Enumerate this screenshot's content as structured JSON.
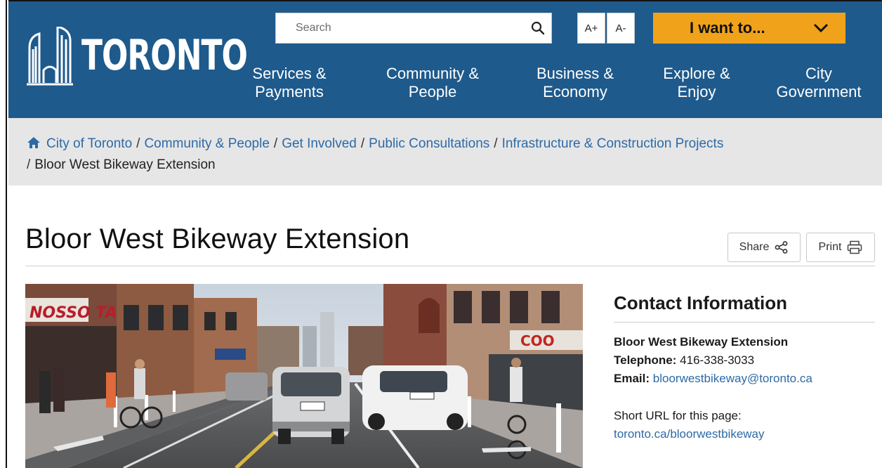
{
  "header": {
    "logo_text": "TORONTO",
    "search_placeholder": "Search",
    "font_increase": "A+",
    "font_decrease": "A-",
    "i_want_to": "I want to...",
    "nav": [
      {
        "line1": "Services &",
        "line2": "Payments"
      },
      {
        "line1": "Community &",
        "line2": "People"
      },
      {
        "line1": "Business &",
        "line2": "Economy"
      },
      {
        "line1": "Explore &",
        "line2": "Enjoy"
      },
      {
        "line1": "City",
        "line2": "Government"
      }
    ]
  },
  "breadcrumb": {
    "items": [
      "City of Toronto",
      "Community & People",
      "Get Involved",
      "Public Consultations",
      "Infrastructure & Construction Projects"
    ],
    "separator": "/",
    "current": "Bloor West Bikeway Extension"
  },
  "page": {
    "title": "Bloor West Bikeway Extension",
    "share_label": "Share",
    "print_label": "Print"
  },
  "contact": {
    "heading": "Contact Information",
    "name": "Bloor West Bikeway Extension",
    "telephone_label": "Telephone:",
    "telephone": "416-338-3033",
    "email_label": "Email:",
    "email": "bloorwestbikeway@toronto.ca",
    "short_url_label": "Short URL for this page:",
    "short_url": "toronto.ca/bloorwestbikeway"
  },
  "hero": {
    "store_sign": "NOSSO TALHO",
    "store_sign2": "COO"
  },
  "colors": {
    "header_bg": "#1e5a8c",
    "accent": "#f0a21a",
    "link": "#2d6aa6",
    "breadcrumb_bg": "#e6e6e6"
  }
}
